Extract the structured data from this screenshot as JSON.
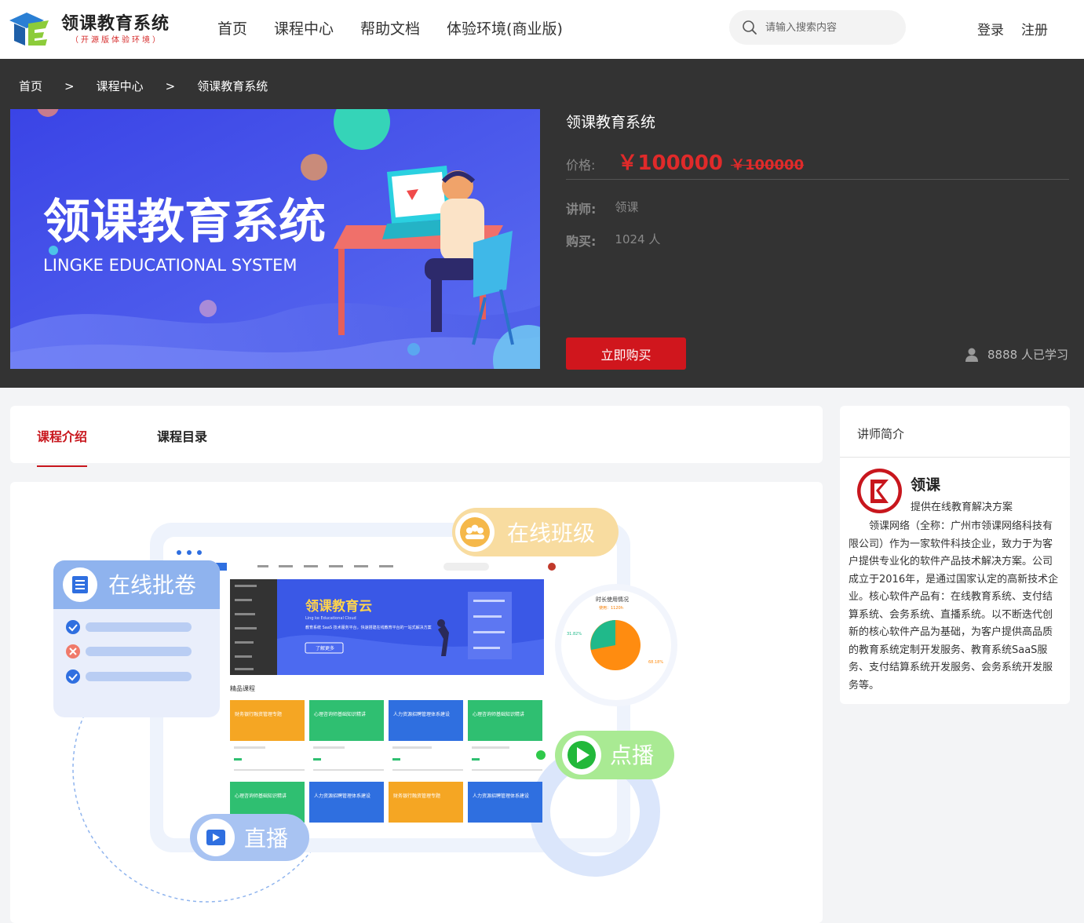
{
  "header": {
    "logo_title": "领课教育系统",
    "logo_sub": "（开源版体验环境）",
    "nav": [
      "首页",
      "课程中心",
      "帮助文档",
      "体验环境(商业版)"
    ],
    "search_placeholder": "请输入搜索内容",
    "login": "登录",
    "register": "注册"
  },
  "breadcrumb": [
    "首页",
    ">",
    "课程中心",
    ">",
    "领课教育系统"
  ],
  "banner": {
    "title": "领课教育系统",
    "subtitle": "LINGKE EDUCATIONAL SYSTEM"
  },
  "course": {
    "title": "领课教育系统",
    "price_label": "价格:",
    "price": "￥100000",
    "original_price": "￥100000",
    "teacher_label": "讲师:",
    "teacher": "领课",
    "buyers_label": "购买:",
    "buyers": "1024 人",
    "buy_button": "立即购买",
    "learners": "8888 人已学习"
  },
  "tabs": [
    "课程介绍",
    "课程目录"
  ],
  "intro_image": {
    "labels": {
      "marking": "在线批卷",
      "class": "在线班级",
      "vod": "点播",
      "live": "直播"
    },
    "mockup": {
      "brand": "领课教育云",
      "brand_en": "Ling ke Educational Cloud",
      "hero_desc": "教育系统 SaaS 技术服务平台，快速搭建在线教育平台的一站式解决方案",
      "hero_btn": "了解更多",
      "section": "精品课程",
      "chart_title": "时长使用情况",
      "chart_sub": "使用：1120h",
      "pct_a": "31.82%",
      "pct_b": "68.18%",
      "cards": [
        {
          "t": "财务银行融资管理专题",
          "c": "#f5a623"
        },
        {
          "t": "心理咨询师基础知识精讲",
          "c": "#2fbf71"
        },
        {
          "t": "人力资源招聘管理体系建设",
          "c": "#2f6fe0"
        },
        {
          "t": "心理咨询师基础知识精讲",
          "c": "#2fbf71"
        },
        {
          "t": "心理咨询师基础知识精讲",
          "c": "#2fbf71"
        },
        {
          "t": "人力资源招聘管理体系建设",
          "c": "#2f6fe0"
        },
        {
          "t": "财务银行融资管理专题",
          "c": "#f5a623"
        },
        {
          "t": "人力资源招聘管理体系建设",
          "c": "#2f6fe0"
        }
      ]
    }
  },
  "teacher_panel": {
    "heading": "讲师简介",
    "name": "领课",
    "tagline": "提供在线教育解决方案",
    "description": "领课网络（全称：广州市领课网络科技有限公司）作为一家软件科技企业，致力于为客户提供专业化的软件产品技术解决方案。公司成立于2016年，是通过国家认定的高新技术企业。核心软件产品有：在线教育系统、支付结算系统、会务系统、直播系统。以不断迭代创新的核心软件产品为基础，为客户提供高品质的教育系统定制开发服务、教育系统SaaS服务、支付结算系统开发服务、会务系统开发服务等。"
  },
  "colors": {
    "accent": "#c8161d",
    "price": "#e02a2a",
    "hero_bg": "#333333"
  }
}
